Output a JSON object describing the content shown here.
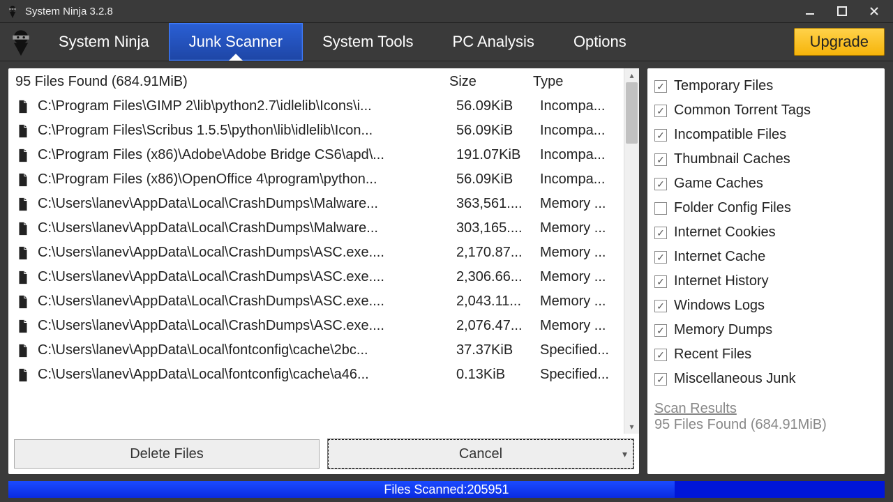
{
  "window": {
    "title": "System Ninja 3.2.8"
  },
  "menu": {
    "brand": "System Ninja",
    "items": [
      {
        "label": "Junk Scanner",
        "active": true
      },
      {
        "label": "System Tools",
        "active": false
      },
      {
        "label": "PC Analysis",
        "active": false
      },
      {
        "label": "Options",
        "active": false
      }
    ],
    "upgrade": "Upgrade"
  },
  "table": {
    "header_found": "95 Files Found (684.91MiB)",
    "header_size": "Size",
    "header_type": "Type",
    "rows": [
      {
        "name": "C:\\Program Files\\GIMP 2\\lib\\python2.7\\idlelib\\Icons\\i...",
        "size": "56.09KiB",
        "type": "Incompa..."
      },
      {
        "name": "C:\\Program Files\\Scribus 1.5.5\\python\\lib\\idlelib\\Icon...",
        "size": "56.09KiB",
        "type": "Incompa..."
      },
      {
        "name": "C:\\Program Files (x86)\\Adobe\\Adobe Bridge CS6\\apd\\...",
        "size": "191.07KiB",
        "type": "Incompa..."
      },
      {
        "name": "C:\\Program Files (x86)\\OpenOffice 4\\program\\python...",
        "size": "56.09KiB",
        "type": "Incompa..."
      },
      {
        "name": "C:\\Users\\lanev\\AppData\\Local\\CrashDumps\\Malware...",
        "size": "363,561....",
        "type": "Memory ..."
      },
      {
        "name": "C:\\Users\\lanev\\AppData\\Local\\CrashDumps\\Malware...",
        "size": "303,165....",
        "type": "Memory ..."
      },
      {
        "name": "C:\\Users\\lanev\\AppData\\Local\\CrashDumps\\ASC.exe....",
        "size": "2,170.87...",
        "type": "Memory ..."
      },
      {
        "name": "C:\\Users\\lanev\\AppData\\Local\\CrashDumps\\ASC.exe....",
        "size": "2,306.66...",
        "type": "Memory ..."
      },
      {
        "name": "C:\\Users\\lanev\\AppData\\Local\\CrashDumps\\ASC.exe....",
        "size": "2,043.11...",
        "type": "Memory ..."
      },
      {
        "name": "C:\\Users\\lanev\\AppData\\Local\\CrashDumps\\ASC.exe....",
        "size": "2,076.47...",
        "type": "Memory ..."
      },
      {
        "name": "C:\\Users\\lanev\\AppData\\Local\\fontconfig\\cache\\2bc...",
        "size": "37.37KiB",
        "type": "Specified..."
      },
      {
        "name": "C:\\Users\\lanev\\AppData\\Local\\fontconfig\\cache\\a46...",
        "size": "0.13KiB",
        "type": "Specified..."
      }
    ]
  },
  "actions": {
    "delete": "Delete Files",
    "cancel": "Cancel"
  },
  "categories": [
    {
      "label": "Temporary Files",
      "checked": true
    },
    {
      "label": "Common Torrent Tags",
      "checked": true
    },
    {
      "label": "Incompatible Files",
      "checked": true
    },
    {
      "label": "Thumbnail Caches",
      "checked": true
    },
    {
      "label": "Game Caches",
      "checked": true
    },
    {
      "label": "Folder Config Files",
      "checked": false
    },
    {
      "label": "Internet Cookies",
      "checked": true
    },
    {
      "label": "Internet Cache",
      "checked": true
    },
    {
      "label": "Internet History",
      "checked": true
    },
    {
      "label": "Windows Logs",
      "checked": true
    },
    {
      "label": "Memory Dumps",
      "checked": true
    },
    {
      "label": "Recent Files",
      "checked": true
    },
    {
      "label": "Miscellaneous Junk",
      "checked": true
    }
  ],
  "results": {
    "label": "Scan Results",
    "count": "95 Files Found (684.91MiB)"
  },
  "progress": {
    "label_pre": "Files Scanned: ",
    "label_value": "205951",
    "percent": 76
  }
}
